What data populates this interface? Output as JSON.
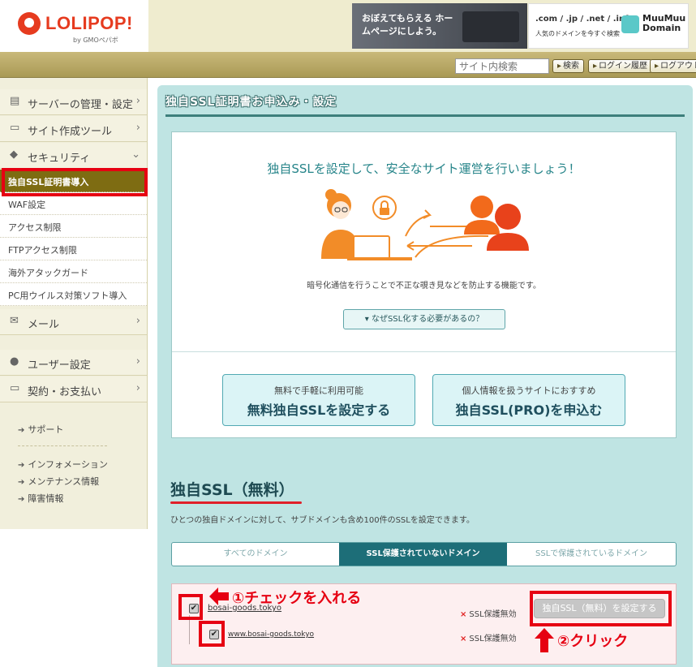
{
  "header": {
    "logo_name": "LOLIPOP!",
    "logo_sub": "by GMOペパボ",
    "banner1_text": "おぼえてもらえる ホームページにしよう。",
    "banner2_domains": ".com / .jp / .net / .info",
    "banner2_sub": "人気のドメインを今すぐ検索",
    "banner2_brand": "MuuMuu Domain"
  },
  "toolbar": {
    "search_placeholder": "サイト内検索",
    "search_label": "検索",
    "history_label": "ログイン履歴",
    "logout_label": "ログアウト"
  },
  "sidebar": {
    "items": [
      {
        "label": "サーバーの管理・設定",
        "icon": "server-icon"
      },
      {
        "label": "サイト作成ツール",
        "icon": "laptop-icon"
      },
      {
        "label": "セキュリティ",
        "icon": "shield-icon"
      }
    ],
    "security_sub": [
      "独自SSL証明書導入",
      "WAF設定",
      "アクセス制限",
      "FTPアクセス制限",
      "海外アタックガード",
      "PC用ウイルス対策ソフト導入"
    ],
    "mail": {
      "label": "メール",
      "icon": "mail-icon"
    },
    "user": {
      "label": "ユーザー設定",
      "icon": "user-icon"
    },
    "billing": {
      "label": "契約・お支払い",
      "icon": "card-icon"
    },
    "links": [
      "サポート",
      "インフォメーション",
      "メンテナンス情報",
      "障害情報"
    ]
  },
  "main": {
    "title": "独自SSL証明書お申込み・設定",
    "intro_heading": "独自SSLを設定して、安全なサイト運営を行いましょう！",
    "intro_desc": "暗号化通信を行うことで不正な覗き見などを防止する機能です。",
    "why_label": "なぜSSL化する必要があるの？",
    "free_btn_small": "無料で手軽に利用可能",
    "free_btn_big": "無料独自SSLを設定する",
    "pro_btn_small": "個人情報を扱うサイトにおすすめ",
    "pro_btn_big": "独自SSL(PRO)を申込む",
    "free_heading": "独自SSL（無料）",
    "free_desc": "ひとつの独自ドメインに対して、サブドメインも含め100件のSSLを設定できます。",
    "tabs": [
      "すべてのドメイン",
      "SSL保護されていないドメイン",
      "SSLで保護されているドメイン"
    ],
    "domains": [
      {
        "name": "bosai-goods.tokyo",
        "status": "SSL保護無効",
        "checked": true
      },
      {
        "name": "www.bosai-goods.tokyo",
        "status": "SSL保護無効",
        "checked": true
      }
    ],
    "set_button": "独自SSL（無料）を設定する"
  },
  "annotations": {
    "step1": "①チェックを入れる",
    "step2": "②クリック"
  },
  "colors": {
    "accent_red": "#e60012",
    "brand_red": "#e63b1f",
    "teal_bg": "#bfe4e3",
    "sidebar_active": "#7e6c12"
  }
}
